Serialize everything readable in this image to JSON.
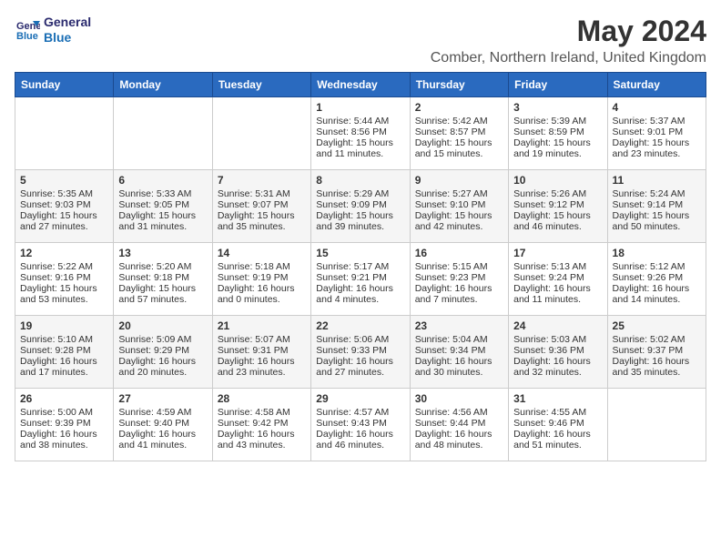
{
  "logo": {
    "line1": "General",
    "line2": "Blue"
  },
  "title": "May 2024",
  "location": "Comber, Northern Ireland, United Kingdom",
  "days_of_week": [
    "Sunday",
    "Monday",
    "Tuesday",
    "Wednesday",
    "Thursday",
    "Friday",
    "Saturday"
  ],
  "weeks": [
    [
      {
        "day": "",
        "content": ""
      },
      {
        "day": "",
        "content": ""
      },
      {
        "day": "",
        "content": ""
      },
      {
        "day": "1",
        "content": "Sunrise: 5:44 AM\nSunset: 8:56 PM\nDaylight: 15 hours\nand 11 minutes."
      },
      {
        "day": "2",
        "content": "Sunrise: 5:42 AM\nSunset: 8:57 PM\nDaylight: 15 hours\nand 15 minutes."
      },
      {
        "day": "3",
        "content": "Sunrise: 5:39 AM\nSunset: 8:59 PM\nDaylight: 15 hours\nand 19 minutes."
      },
      {
        "day": "4",
        "content": "Sunrise: 5:37 AM\nSunset: 9:01 PM\nDaylight: 15 hours\nand 23 minutes."
      }
    ],
    [
      {
        "day": "5",
        "content": "Sunrise: 5:35 AM\nSunset: 9:03 PM\nDaylight: 15 hours\nand 27 minutes."
      },
      {
        "day": "6",
        "content": "Sunrise: 5:33 AM\nSunset: 9:05 PM\nDaylight: 15 hours\nand 31 minutes."
      },
      {
        "day": "7",
        "content": "Sunrise: 5:31 AM\nSunset: 9:07 PM\nDaylight: 15 hours\nand 35 minutes."
      },
      {
        "day": "8",
        "content": "Sunrise: 5:29 AM\nSunset: 9:09 PM\nDaylight: 15 hours\nand 39 minutes."
      },
      {
        "day": "9",
        "content": "Sunrise: 5:27 AM\nSunset: 9:10 PM\nDaylight: 15 hours\nand 42 minutes."
      },
      {
        "day": "10",
        "content": "Sunrise: 5:26 AM\nSunset: 9:12 PM\nDaylight: 15 hours\nand 46 minutes."
      },
      {
        "day": "11",
        "content": "Sunrise: 5:24 AM\nSunset: 9:14 PM\nDaylight: 15 hours\nand 50 minutes."
      }
    ],
    [
      {
        "day": "12",
        "content": "Sunrise: 5:22 AM\nSunset: 9:16 PM\nDaylight: 15 hours\nand 53 minutes."
      },
      {
        "day": "13",
        "content": "Sunrise: 5:20 AM\nSunset: 9:18 PM\nDaylight: 15 hours\nand 57 minutes."
      },
      {
        "day": "14",
        "content": "Sunrise: 5:18 AM\nSunset: 9:19 PM\nDaylight: 16 hours\nand 0 minutes."
      },
      {
        "day": "15",
        "content": "Sunrise: 5:17 AM\nSunset: 9:21 PM\nDaylight: 16 hours\nand 4 minutes."
      },
      {
        "day": "16",
        "content": "Sunrise: 5:15 AM\nSunset: 9:23 PM\nDaylight: 16 hours\nand 7 minutes."
      },
      {
        "day": "17",
        "content": "Sunrise: 5:13 AM\nSunset: 9:24 PM\nDaylight: 16 hours\nand 11 minutes."
      },
      {
        "day": "18",
        "content": "Sunrise: 5:12 AM\nSunset: 9:26 PM\nDaylight: 16 hours\nand 14 minutes."
      }
    ],
    [
      {
        "day": "19",
        "content": "Sunrise: 5:10 AM\nSunset: 9:28 PM\nDaylight: 16 hours\nand 17 minutes."
      },
      {
        "day": "20",
        "content": "Sunrise: 5:09 AM\nSunset: 9:29 PM\nDaylight: 16 hours\nand 20 minutes."
      },
      {
        "day": "21",
        "content": "Sunrise: 5:07 AM\nSunset: 9:31 PM\nDaylight: 16 hours\nand 23 minutes."
      },
      {
        "day": "22",
        "content": "Sunrise: 5:06 AM\nSunset: 9:33 PM\nDaylight: 16 hours\nand 27 minutes."
      },
      {
        "day": "23",
        "content": "Sunrise: 5:04 AM\nSunset: 9:34 PM\nDaylight: 16 hours\nand 30 minutes."
      },
      {
        "day": "24",
        "content": "Sunrise: 5:03 AM\nSunset: 9:36 PM\nDaylight: 16 hours\nand 32 minutes."
      },
      {
        "day": "25",
        "content": "Sunrise: 5:02 AM\nSunset: 9:37 PM\nDaylight: 16 hours\nand 35 minutes."
      }
    ],
    [
      {
        "day": "26",
        "content": "Sunrise: 5:00 AM\nSunset: 9:39 PM\nDaylight: 16 hours\nand 38 minutes."
      },
      {
        "day": "27",
        "content": "Sunrise: 4:59 AM\nSunset: 9:40 PM\nDaylight: 16 hours\nand 41 minutes."
      },
      {
        "day": "28",
        "content": "Sunrise: 4:58 AM\nSunset: 9:42 PM\nDaylight: 16 hours\nand 43 minutes."
      },
      {
        "day": "29",
        "content": "Sunrise: 4:57 AM\nSunset: 9:43 PM\nDaylight: 16 hours\nand 46 minutes."
      },
      {
        "day": "30",
        "content": "Sunrise: 4:56 AM\nSunset: 9:44 PM\nDaylight: 16 hours\nand 48 minutes."
      },
      {
        "day": "31",
        "content": "Sunrise: 4:55 AM\nSunset: 9:46 PM\nDaylight: 16 hours\nand 51 minutes."
      },
      {
        "day": "",
        "content": ""
      }
    ]
  ]
}
